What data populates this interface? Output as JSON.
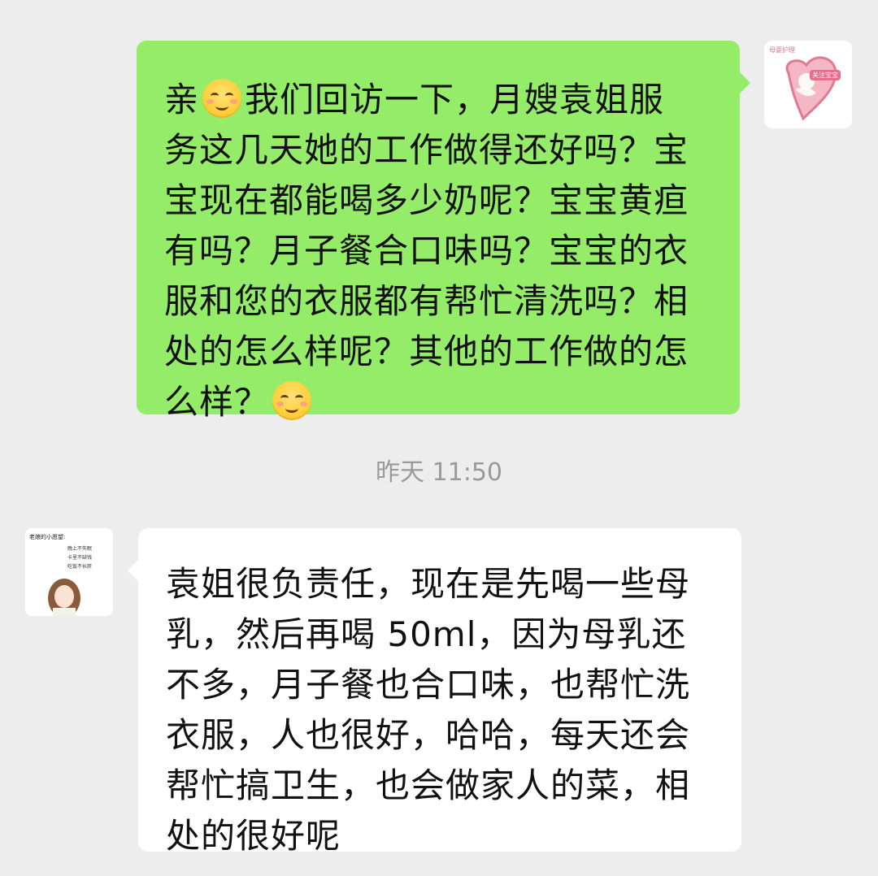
{
  "outgoing_message": {
    "lines": [
      [
        "亲",
        "EMOJI",
        "我们回访一下，月嫂袁姐服"
      ],
      [
        "务这几天她的工作做得还好吗？宝"
      ],
      [
        "宝现在都能喝多少奶呢？宝宝黄疸"
      ],
      [
        "有吗？月子餐合口味吗？宝宝的衣"
      ],
      [
        "服和您的衣服都有帮忙清洗吗？相"
      ],
      [
        "处的怎么样呢？其他的工作做的怎"
      ],
      [
        "么样？",
        "EMOJI"
      ]
    ],
    "line_1_a": "亲",
    "line_1_b": "我们回访一下，月嫂袁姐服",
    "line_2": "务这几天她的工作做得还好吗？宝",
    "line_3": "宝现在都能喝多少奶呢？宝宝黄疸",
    "line_4": "有吗？月子餐合口味吗？宝宝的衣",
    "line_5": "服和您的衣服都有帮忙清洗吗？相",
    "line_6": "处的怎么样呢？其他的工作做的怎",
    "line_7": "么样？",
    "emoji": "smiling-face-icon"
  },
  "timestamp": "昨天 11:50",
  "incoming_message": {
    "line_1": "袁姐很负责任，现在是先喝一些母",
    "line_2": "乳，然后再喝 50ml，因为母乳还",
    "line_3": "不多，月子餐也合口味，也帮忙洗",
    "line_4": "衣服，人也很好，哈哈，每天还会",
    "line_5": "帮忙搞卫生，也会做家人的菜，相",
    "line_6": "处的很好呢"
  },
  "right_avatar": {
    "top_text": "母婴护理",
    "tag_text": "关注宝宝"
  },
  "left_avatar": {
    "title": "老娘的小愿望:",
    "wish_1": "晚上不失眠",
    "wish_2": "卡里不缺钱",
    "wish_3": "吃饭不长胖"
  },
  "colors": {
    "background": "#ededed",
    "outgoing_bubble": "#95ec69",
    "incoming_bubble": "#ffffff",
    "timestamp_text": "#9a9a9a"
  }
}
